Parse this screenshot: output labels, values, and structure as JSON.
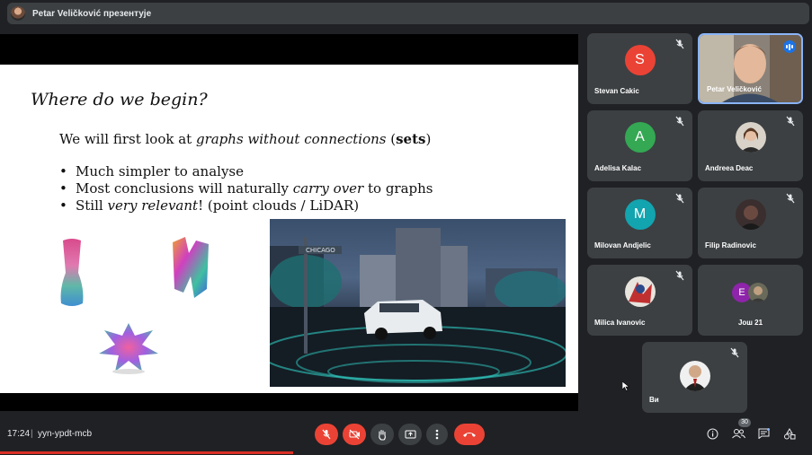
{
  "topbar": {
    "presenter_text": "Petar Veličković презентује"
  },
  "slide": {
    "title": "Where do we begin?",
    "lead_prefix": "We will first look at ",
    "lead_italic": "graphs without connections",
    "lead_bold": "sets",
    "bullet_1": "Much simpler to analyse",
    "bullet_2_prefix": "Most conclusions will naturally ",
    "bullet_2_italic": "carry over",
    "bullet_2_suffix": " to graphs",
    "bullet_3_prefix": "Still ",
    "bullet_3_italic": "very relevant",
    "bullet_3_suffix": "! (point clouds / LiDAR)",
    "sign_text": "CHICAGO"
  },
  "participants": [
    {
      "name": "Stevan Cakic",
      "letter": "S",
      "color": "#ea4335",
      "muted": true
    },
    {
      "name": "Petar Veličković",
      "speaking": true
    },
    {
      "name": "Adelisa Kalac",
      "letter": "A",
      "color": "#34a853",
      "muted": true
    },
    {
      "name": "Andreea Deac",
      "muted": true
    },
    {
      "name": "Milovan Andjelic",
      "letter": "M",
      "color": "#12a4af",
      "muted": true
    },
    {
      "name": "Filip Radinovic",
      "muted": true
    },
    {
      "name": "Milica Ivanovic",
      "muted": true
    },
    {
      "name": "Још 21",
      "letter": "E",
      "color": "#8e24aa"
    },
    {
      "name": "Ви",
      "muted": true
    }
  ],
  "bottom": {
    "time": "17:24",
    "separator": "|",
    "meeting_code": "yyn-ypdt-mcb",
    "people_count": "30"
  },
  "colors": {
    "accent": "#8ab4f8",
    "danger": "#ea4335",
    "tile": "#3c4043",
    "bg": "#202124"
  }
}
